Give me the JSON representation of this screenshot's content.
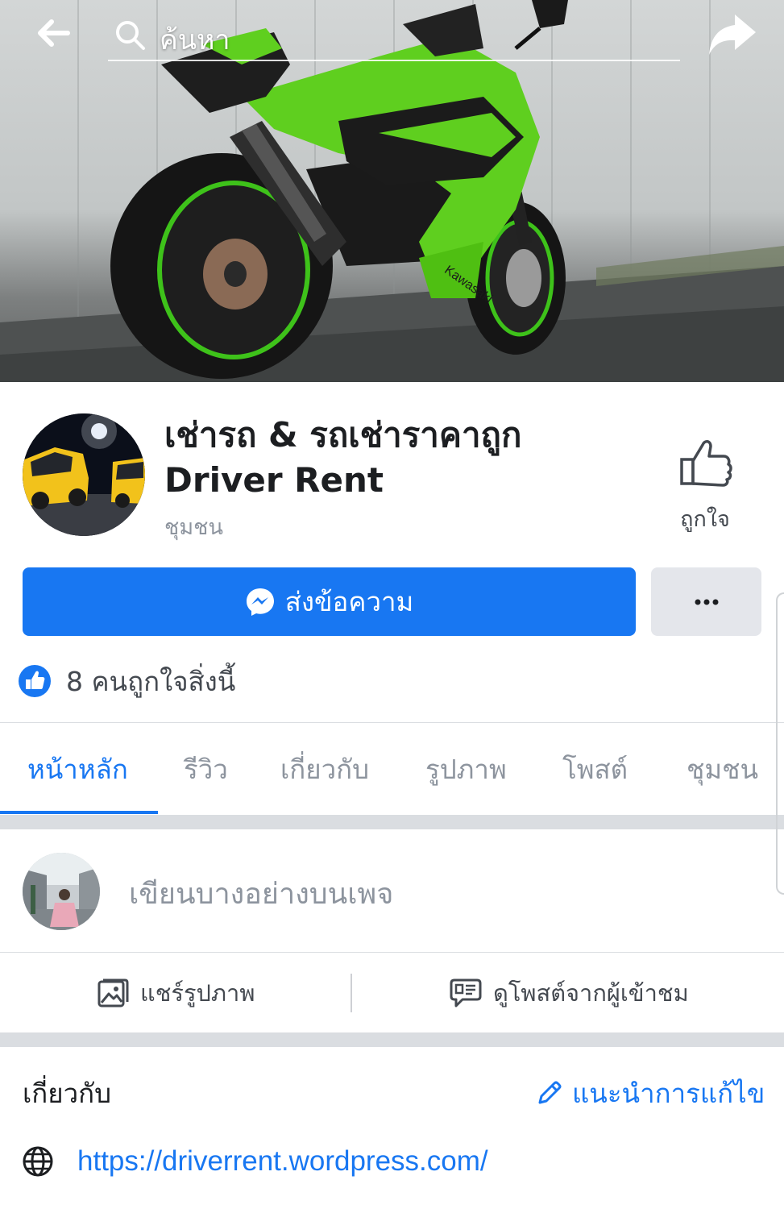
{
  "topbar": {
    "search_label": "ค้นหา",
    "back_icon": "arrow-left-icon",
    "share_icon": "share-arrow-icon"
  },
  "page": {
    "title": "เช่ารถ & รถเช่าราคาถูก Driver Rent",
    "category": "ชุมชน",
    "like_button_label": "ถูกใจ",
    "message_button_label": "ส่งข้อความ",
    "more_button_label": "•••",
    "likes_text": "8 คนถูกใจสิ่งนี้"
  },
  "tabs": [
    {
      "label": "หน้าหลัก",
      "active": true
    },
    {
      "label": "รีวิว",
      "active": false
    },
    {
      "label": "เกี่ยวกับ",
      "active": false
    },
    {
      "label": "รูปภาพ",
      "active": false
    },
    {
      "label": "โพสต์",
      "active": false
    },
    {
      "label": "ชุมชน",
      "active": false
    }
  ],
  "composer": {
    "placeholder": "เขียนบางอย่างบนเพจ",
    "share_photo_label": "แชร์รูปภาพ",
    "visitor_posts_label": "ดูโพสต์จากผู้เข้าชม"
  },
  "about": {
    "title": "เกี่ยวกับ",
    "suggest_edit_label": "แนะนำการแก้ไข",
    "website": "https://driverrent.wordpress.com/"
  },
  "colors": {
    "accent": "#1877f2",
    "secondary_text": "#8d949e",
    "separator": "#dadde1",
    "bike_green": "#5fcf1f"
  }
}
